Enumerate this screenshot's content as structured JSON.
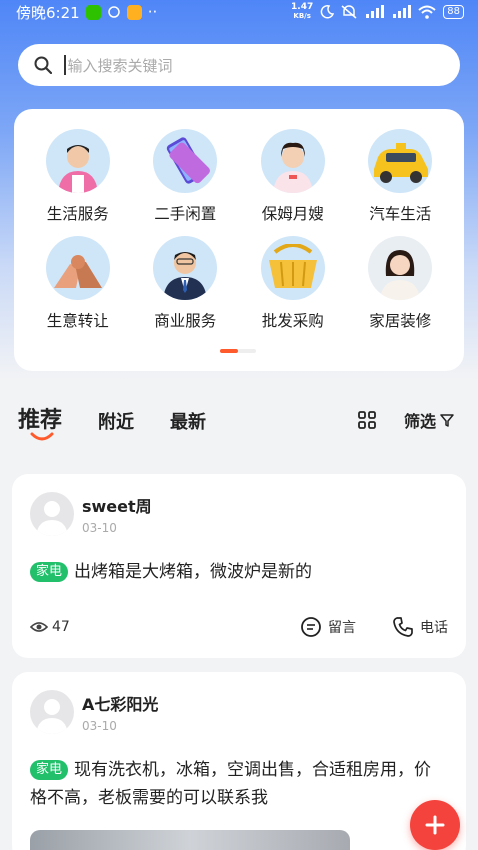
{
  "status_bar": {
    "time": "傍晚6:21",
    "net_speed_value": "1.47",
    "net_speed_unit": "KB/s",
    "battery": "88"
  },
  "search": {
    "placeholder": "输入搜索关键词"
  },
  "categories": [
    {
      "label": "生活服务"
    },
    {
      "label": "二手闲置"
    },
    {
      "label": "保姆月嫂"
    },
    {
      "label": "汽车生活"
    },
    {
      "label": "生意转让"
    },
    {
      "label": "商业服务"
    },
    {
      "label": "批发采购"
    },
    {
      "label": "家居装修"
    }
  ],
  "tabs": [
    {
      "label": "推荐",
      "active": true
    },
    {
      "label": "附近"
    },
    {
      "label": "最新"
    }
  ],
  "filter_label": "筛选",
  "posts": [
    {
      "user": "sweet周",
      "date": "03-10",
      "tag": "家电",
      "text": "出烤箱是大烤箱，微波炉是新的",
      "views": "47",
      "comment_label": "留言",
      "phone_label": "电话"
    },
    {
      "user": "A七彩阳光",
      "date": "03-10",
      "tag": "家电",
      "text": "现有洗衣机，冰箱，空调出售，合适租房用，价格不高，老板需要的可以联系我"
    }
  ],
  "colors": {
    "accent": "#ff5a2c",
    "tag_green": "#22c06b",
    "fab_red": "#f4433c",
    "header_blue": "#4f86f7"
  }
}
